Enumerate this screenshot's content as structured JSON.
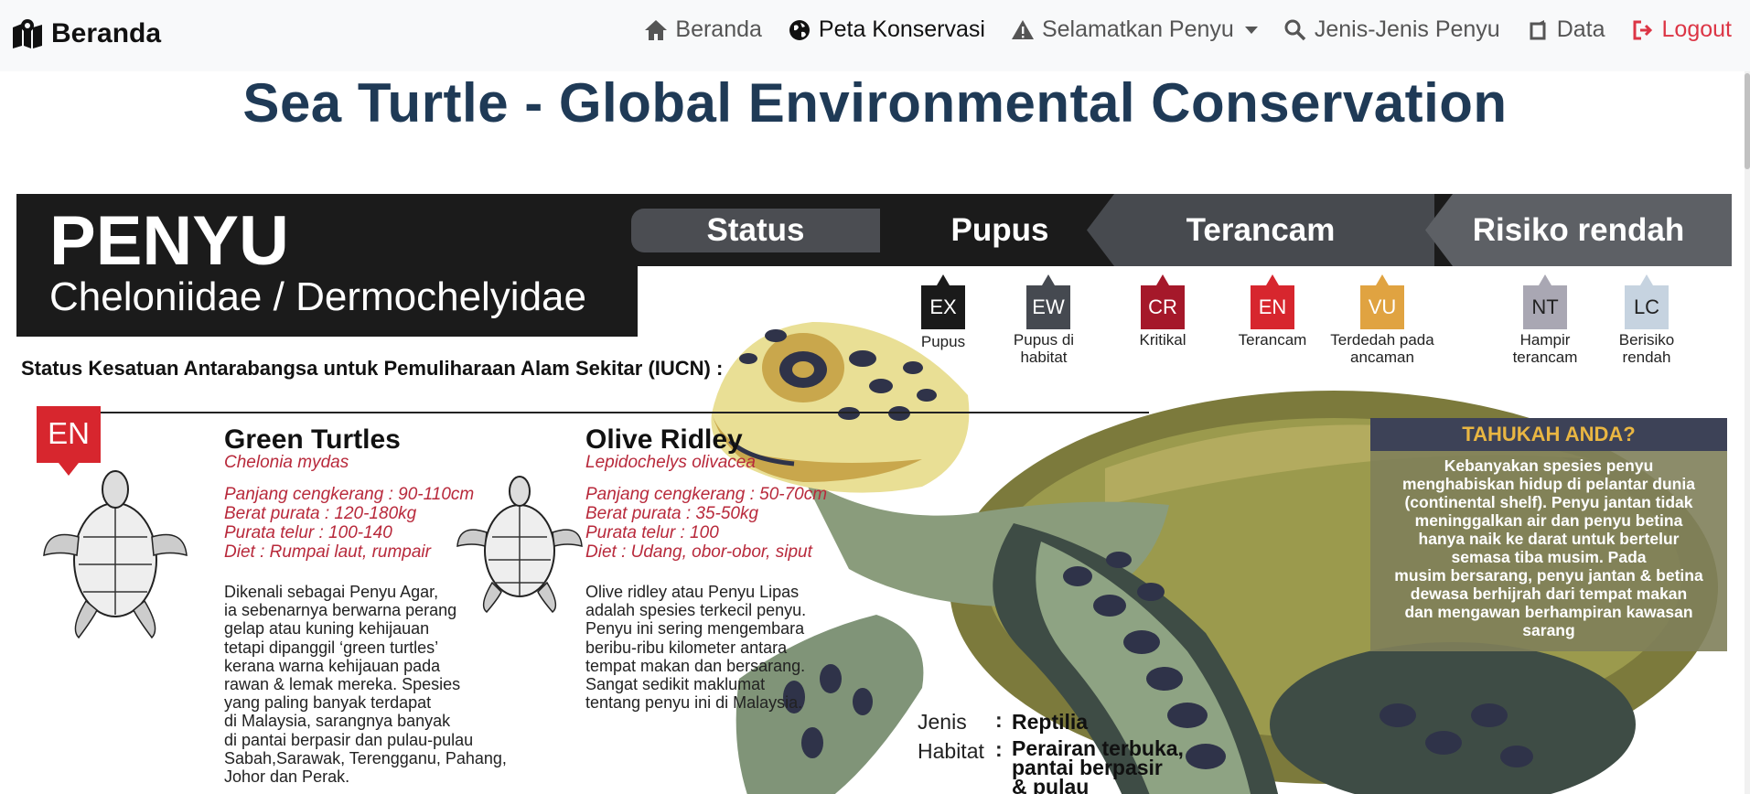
{
  "navbar": {
    "brand": "Beranda",
    "items": [
      {
        "label": "Beranda",
        "icon": "home-icon"
      },
      {
        "label": "Peta Konservasi",
        "icon": "globe-icon"
      },
      {
        "label": "Selamatkan Penyu",
        "icon": "warning-icon"
      },
      {
        "label": "Jenis-Jenis Penyu",
        "icon": "search-icon"
      },
      {
        "label": "Data",
        "icon": "data-icon"
      },
      {
        "label": "Logout",
        "icon": "logout-icon"
      }
    ]
  },
  "page_title": "Sea Turtle - Global Environmental Conservation",
  "infographic": {
    "title": "PENYU",
    "subtitle": "Cheloniidae / Dermochelyidae",
    "tabs": {
      "status": "Status",
      "pupus": "Pupus",
      "terancam": "Terancam",
      "risiko": "Risiko rendah"
    },
    "badges": [
      {
        "code": "EX",
        "label": "Pupus",
        "color": "#1a1a1a"
      },
      {
        "code": "EW",
        "label": "Pupus di habitat",
        "color": "#454950"
      },
      {
        "code": "CR",
        "label": "Kritikal",
        "color": "#a5182a"
      },
      {
        "code": "EN",
        "label": "Terancam",
        "color": "#d7262e"
      },
      {
        "code": "VU",
        "label": "Terdedah pada ancaman",
        "color": "#e0a341"
      },
      {
        "code": "NT",
        "label": "Hampir terancam",
        "color": "#a9a7b3"
      },
      {
        "code": "LC",
        "label": "Berisiko rendah",
        "color": "#c6d3e0"
      }
    ],
    "iucn_heading": "Status Kesatuan Antarabangsa untuk Pemuliharaan Alam Sekitar (IUCN) :",
    "en_tag": "EN",
    "species": [
      {
        "name": "Green Turtles",
        "scientific": "Chelonia mydas",
        "shell": "Panjang cengkerang : 90-110cm",
        "weight": "Berat purata : 120-180kg",
        "eggs": "Purata telur : 100-140",
        "diet": "Diet : Rumpai laut, rumpair",
        "desc": [
          "Dikenali sebagai Penyu Agar,",
          "ia sebenarnya berwarna perang",
          "gelap atau kuning kehijauan",
          "tetapi dipanggil ‘green turtles’",
          "kerana warna kehijauan pada",
          "rawan & lemak mereka. Spesies",
          "yang paling banyak terdapat",
          "di Malaysia, sarangnya banyak",
          "di pantai berpasir dan pulau-pulau",
          "Sabah,Sarawak, Terengganu, Pahang,",
          "Johor dan Perak."
        ]
      },
      {
        "name": "Olive Ridley",
        "scientific": "Lepidochelys olivacea",
        "shell": "Panjang cengkerang : 50-70cm",
        "weight": "Berat purata : 35-50kg",
        "eggs": "Purata telur : 100",
        "diet": "Diet : Udang, obor-obor, siput",
        "desc": [
          "Olive ridley atau Penyu Lipas",
          "adalah spesies terkecil penyu.",
          "Penyu ini sering mengembara",
          "beribu-ribu kilometer antara",
          "tempat makan dan bersarang.",
          "Sangat sedikit maklumat",
          "tentang penyu ini di Malaysia."
        ]
      }
    ],
    "tahukah_title": "TAHUKAH ANDA?",
    "tahukah_lines": [
      "Kebanyakan spesies penyu",
      "menghabiskan hidup di pelantar dunia",
      "(continental shelf). Penyu jantan tidak",
      "meninggalkan air dan penyu betina",
      "hanya naik ke darat untuk bertelur",
      "semasa tiba musim. Pada",
      "musim bersarang, penyu jantan & betina",
      "dewasa berhijrah dari tempat makan",
      "dan mengawan berhampiran kawasan",
      "sarang"
    ],
    "jenis_label": "Jenis",
    "jenis_value": "Reptilia",
    "habitat_label": "Habitat",
    "habitat_lines": [
      "Perairan terbuka,",
      "pantai berpasir",
      "& pulau"
    ]
  }
}
